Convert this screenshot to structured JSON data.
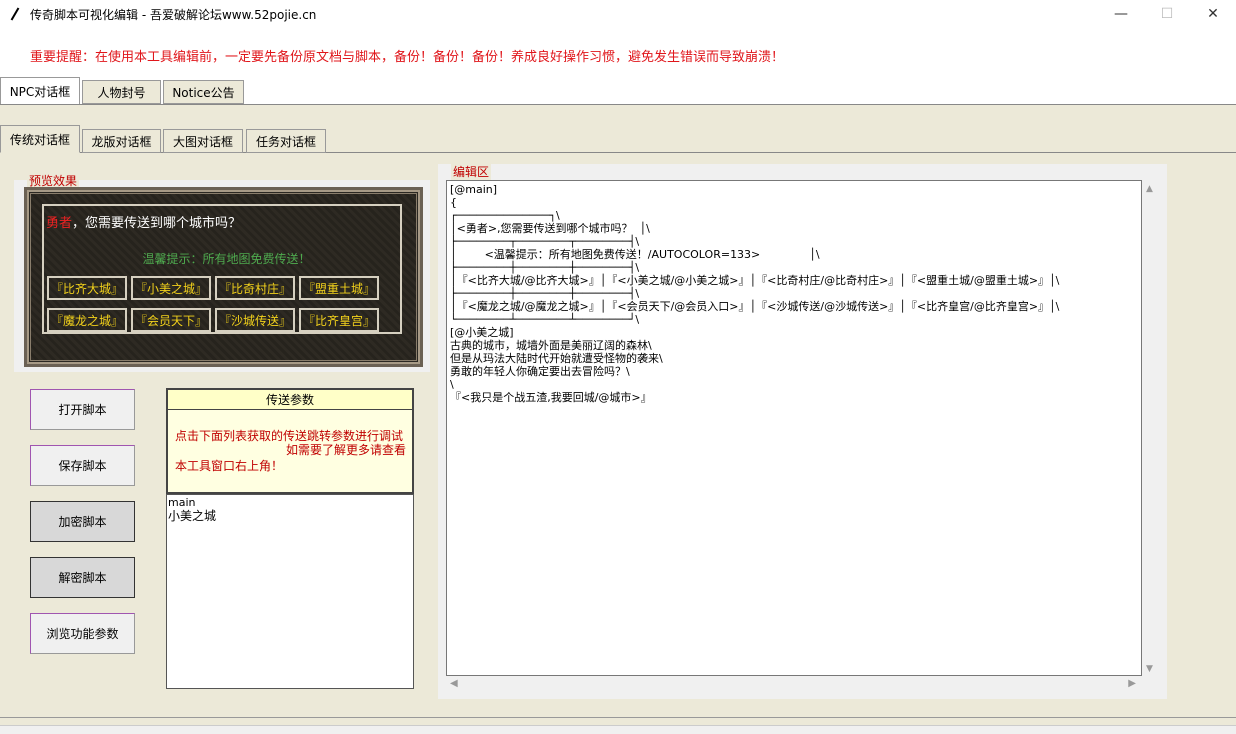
{
  "window": {
    "title": "传奇脚本可视化编辑 - 吾爱破解论坛www.52pojie.cn",
    "minimize": "—",
    "maximize": "☐",
    "close": "✕"
  },
  "warning": "重要提醒：在使用本工具编辑前，一定要先备份原文档与脚本，备份！备份！备份！养成良好操作习惯，避免发生错误而导致崩溃！",
  "outer_tabs": [
    "NPC对话框",
    "人物封号",
    "Notice公告"
  ],
  "inner_tabs": [
    "传统对话框",
    "龙版对话框",
    "大图对话框",
    "任务对话框"
  ],
  "preview": {
    "label": "预览效果",
    "hero": "勇者",
    "question": "，您需要传送到哪个城市吗？",
    "tip": "温馨提示：所有地图免费传送！",
    "row1": [
      "『比齐大城』",
      "『小美之城』",
      "『比奇村庄』",
      "『盟重土城』"
    ],
    "row2": [
      "『魔龙之城』",
      "『会员天下』",
      "『沙城传送』",
      "『比齐皇宫』"
    ]
  },
  "buttons": {
    "open": "打开脚本",
    "save": "保存脚本",
    "encrypt": "加密脚本",
    "decrypt": "解密脚本",
    "browse": "浏览功能参数"
  },
  "params": {
    "title": "传送参数",
    "line1": "点击下面列表获取的传送跳转参数进行调试",
    "line2": "如需要了解更多请查看",
    "line3": "本工具窗口右上角！"
  },
  "labels_list": [
    "main",
    "小美之城"
  ],
  "editor": {
    "label": "编辑区",
    "content": "[@main]\n{\n┌──────────────┐\\\n│<勇者>,您需要传送到哪个城市吗？  │\\\n├────────┬────────┬────────┤\\\n│        <温馨提示：所有地图免费传送！/AUTOCOLOR=133>              │\\\n├────────┼────────┼────────┤\\\n│『<比齐大城/@比齐大城>』│『<小美之城/@小美之城>』│『<比奇村庄/@比奇村庄>』│『<盟重土城/@盟重土城>』│\\\n├────────┼────────┼────────┤\\\n│『<魔龙之城/@魔龙之城>』│『<会员天下/@会员入口>』│『<沙城传送/@沙城传送>』│『<比齐皇宫/@比齐皇宫>』│\\\n└────────┴────────┴────────┘\\\n[@小美之城]\n古典的城市，城墙外面是美丽辽阔的森林\\\n但是从玛法大陆时代开始就遭受怪物的袭来\\\n勇敢的年轻人你确定要出去冒险吗？\\\n\\\n『<我只是个战五渣,我要回城/@城市>』"
  }
}
